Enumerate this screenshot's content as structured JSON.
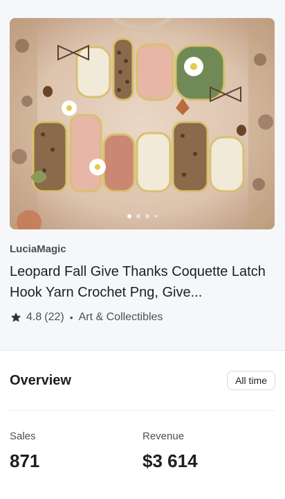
{
  "product": {
    "image_alt_icon": "sweater-design-image",
    "carousel": {
      "count": 4,
      "active": 0
    },
    "shop": "LuciaMagic",
    "title": "Leopard Fall Give Thanks Coquette Latch Hook Yarn Crochet Png, Give...",
    "rating": "4.8",
    "reviews": "(22)",
    "separator": "•",
    "category": "Art & Collectibles"
  },
  "overview": {
    "title": "Overview",
    "range_button": "All time",
    "stats": [
      {
        "label": "Sales",
        "value": "871"
      },
      {
        "label": "Revenue",
        "value": "$3 614"
      }
    ]
  }
}
